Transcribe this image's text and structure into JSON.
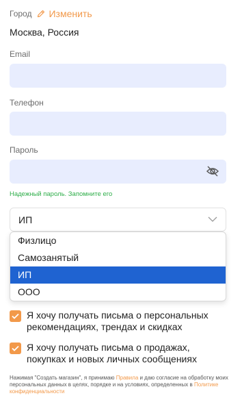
{
  "city": {
    "label": "Город",
    "edit_label": "Изменить",
    "value": "Москва, Россия"
  },
  "email": {
    "label": "Email",
    "value": ""
  },
  "phone": {
    "label": "Телефон",
    "value": ""
  },
  "password": {
    "label": "Пароль",
    "value": "",
    "hint": "Надежный пароль. Запомните его"
  },
  "legal_form": {
    "selected": "ИП",
    "options": [
      "Физлицо",
      "Самозанятый",
      "ИП",
      "ООО"
    ]
  },
  "checkboxes": [
    {
      "text": "Я хочу получать письма о персональных рекомендациях, трендах и скидках",
      "checked": true
    },
    {
      "text": "Я хочу получать письма о продажах, покупках и новых личных сообщениях",
      "checked": true
    }
  ],
  "legal": {
    "part1": "Нажимая \"Создать магазин\", я принимаю ",
    "rules_link": "Правила",
    "part2": " и даю согласие на обработку моих персональных данных в целях, порядке и на условиях, определенных в ",
    "privacy_link": "Политике конфиденциальности"
  },
  "colors": {
    "accent": "#f2994a",
    "input_bg": "#e8edfe",
    "selected_option": "#1f63d1",
    "hint": "#2fae4a"
  },
  "icons": [
    "pencil-icon",
    "eye-off-icon",
    "chevron-down-icon",
    "check-icon"
  ]
}
